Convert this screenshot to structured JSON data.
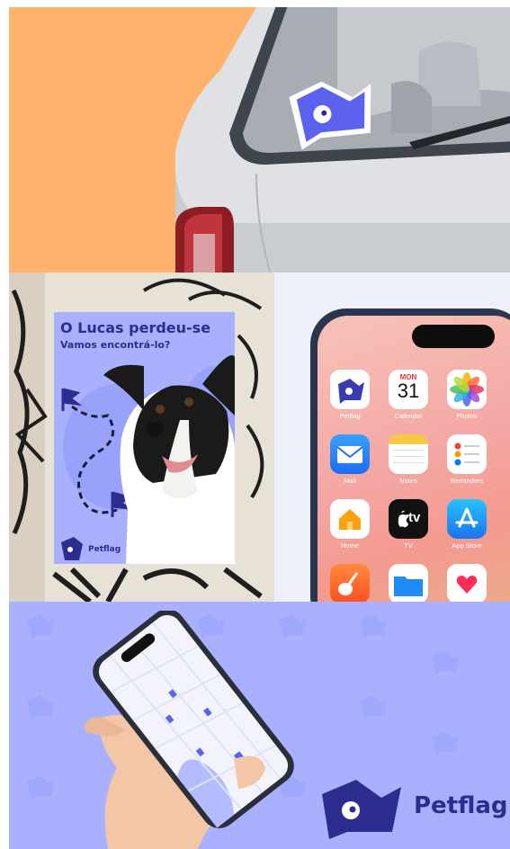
{
  "poster": {
    "title": "O Lucas perdeu-se",
    "subtitle": "Vamos encontrá-lo?",
    "brand": "Petflag"
  },
  "home_screen": {
    "calendar_day": "MON",
    "calendar_date": "31",
    "tv_label": "tv",
    "apps": [
      {
        "label": "Petflag",
        "icon": "petflag-app-icon"
      },
      {
        "label": "Calendar",
        "icon": "calendar-icon"
      },
      {
        "label": "Photos",
        "icon": "photos-icon"
      },
      {
        "label": "Mail",
        "icon": "mail-icon"
      },
      {
        "label": "Notes",
        "icon": "notes-icon"
      },
      {
        "label": "Reminders",
        "icon": "reminders-icon"
      },
      {
        "label": "Home",
        "icon": "home-icon"
      },
      {
        "label": "TV",
        "icon": "tv-icon"
      },
      {
        "label": "App Store",
        "icon": "app-store-icon"
      },
      {
        "label": "",
        "icon": "garageband-icon"
      },
      {
        "label": "",
        "icon": "files-icon"
      },
      {
        "label": "",
        "icon": "health-icon"
      }
    ]
  },
  "lockup": {
    "brand": "Petflag"
  },
  "colors": {
    "brand_dark": "#2d2c8f",
    "brand_light": "#a9b1ff",
    "orange": "#ffb26b"
  }
}
